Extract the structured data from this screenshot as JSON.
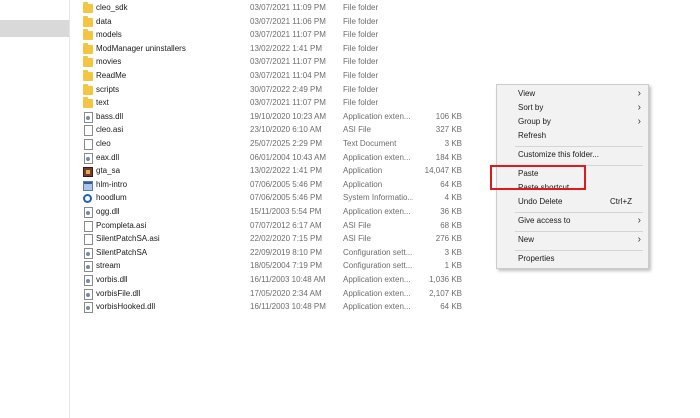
{
  "files": [
    {
      "icon": "folder",
      "name": "cleo_sdk",
      "date": "03/07/2021 11:09 PM",
      "type": "File folder",
      "size": ""
    },
    {
      "icon": "folder",
      "name": "data",
      "date": "03/07/2021 11:06 PM",
      "type": "File folder",
      "size": ""
    },
    {
      "icon": "folder",
      "name": "models",
      "date": "03/07/2021 11:07 PM",
      "type": "File folder",
      "size": ""
    },
    {
      "icon": "folder",
      "name": "ModManager uninstallers",
      "date": "13/02/2022 1:41 PM",
      "type": "File folder",
      "size": ""
    },
    {
      "icon": "folder",
      "name": "movies",
      "date": "03/07/2021 11:07 PM",
      "type": "File folder",
      "size": ""
    },
    {
      "icon": "folder",
      "name": "ReadMe",
      "date": "03/07/2021 11:04 PM",
      "type": "File folder",
      "size": ""
    },
    {
      "icon": "folder",
      "name": "scripts",
      "date": "30/07/2022 2:49 PM",
      "type": "File folder",
      "size": ""
    },
    {
      "icon": "folder",
      "name": "text",
      "date": "03/07/2021 11:07 PM",
      "type": "File folder",
      "size": ""
    },
    {
      "icon": "gear",
      "name": "bass.dll",
      "date": "19/10/2020 10:23 AM",
      "type": "Application exten...",
      "size": "106 KB"
    },
    {
      "icon": "file",
      "name": "cleo.asi",
      "date": "23/10/2020 6:10 AM",
      "type": "ASI File",
      "size": "327 KB"
    },
    {
      "icon": "file",
      "name": "cleo",
      "date": "25/07/2025 2:29 PM",
      "type": "Text Document",
      "size": "3 KB"
    },
    {
      "icon": "gear",
      "name": "eax.dll",
      "date": "06/01/2004 10:43 AM",
      "type": "Application exten...",
      "size": "184 KB"
    },
    {
      "icon": "game",
      "name": "gta_sa",
      "date": "13/02/2022 1:41 PM",
      "type": "Application",
      "size": "14,047 KB"
    },
    {
      "icon": "app",
      "name": "hlm-intro",
      "date": "07/06/2005 5:46 PM",
      "type": "Application",
      "size": "64 KB"
    },
    {
      "icon": "sys",
      "name": "hoodlum",
      "date": "07/06/2005 5:46 PM",
      "type": "System Informatio...",
      "size": "4 KB"
    },
    {
      "icon": "gear",
      "name": "ogg.dll",
      "date": "15/11/2003 5:54 PM",
      "type": "Application exten...",
      "size": "36 KB"
    },
    {
      "icon": "file",
      "name": "Pcompleta.asi",
      "date": "07/07/2012 6:17 AM",
      "type": "ASI File",
      "size": "68 KB"
    },
    {
      "icon": "file",
      "name": "SilentPatchSA.asi",
      "date": "22/02/2020 7:15 PM",
      "type": "ASI File",
      "size": "276 KB"
    },
    {
      "icon": "gear",
      "name": "SilentPatchSA",
      "date": "22/09/2019 8:10 PM",
      "type": "Configuration sett...",
      "size": "3 KB"
    },
    {
      "icon": "gear",
      "name": "stream",
      "date": "18/05/2004 7:19 PM",
      "type": "Configuration sett...",
      "size": "1 KB"
    },
    {
      "icon": "gear",
      "name": "vorbis.dll",
      "date": "16/11/2003 10:48 AM",
      "type": "Application exten...",
      "size": "1,036 KB"
    },
    {
      "icon": "gear",
      "name": "vorbisFile.dll",
      "date": "17/05/2020 2:34 AM",
      "type": "Application exten...",
      "size": "2,107 KB"
    },
    {
      "icon": "gear",
      "name": "vorbisHooked.dll",
      "date": "16/11/2003 10:48 PM",
      "type": "Application exten...",
      "size": "64 KB"
    }
  ],
  "context_menu": {
    "view": "View",
    "sort_by": "Sort by",
    "group_by": "Group by",
    "refresh": "Refresh",
    "customize": "Customize this folder...",
    "paste": "Paste",
    "paste_shortcut": "Paste shortcut",
    "undo_delete": "Undo Delete",
    "undo_shortcut": "Ctrl+Z",
    "give_access": "Give access to",
    "new": "New",
    "properties": "Properties"
  },
  "colors": {
    "highlight_box": "#e0191c",
    "folder": "#f4c542",
    "menu_bg": "#f2f2f2"
  }
}
